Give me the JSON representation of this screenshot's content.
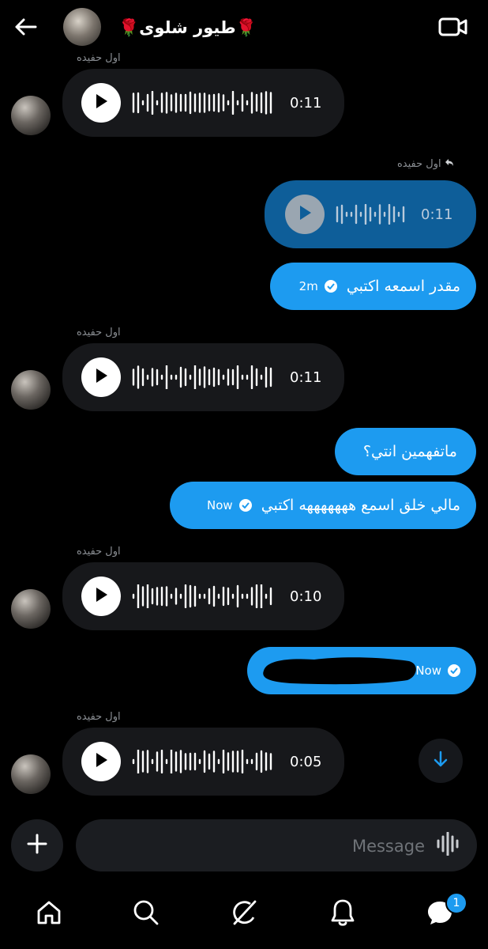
{
  "header": {
    "title": "🌹طيور شلوى🌹",
    "back_icon": "arrow-left-icon",
    "video_icon": "video-call-icon"
  },
  "messages": [
    {
      "type": "voice",
      "direction": "in",
      "sender": "اول حفيده",
      "duration": "0:11"
    },
    {
      "type": "voice",
      "direction": "out",
      "reply_to": "اول حفيده",
      "duration": "0:11"
    },
    {
      "type": "text",
      "direction": "out",
      "text": "مقدر اسمعه اكتبي",
      "time": "2m",
      "status_icon": "read-check-icon"
    },
    {
      "type": "voice",
      "direction": "in",
      "sender": "اول حفيده",
      "duration": "0:11"
    },
    {
      "type": "text",
      "direction": "out",
      "text": "ماتفهمين انتي؟"
    },
    {
      "type": "text",
      "direction": "out",
      "text": "مالي خلق اسمع هههههههه اكتبي",
      "time": "Now",
      "status_icon": "read-check-icon"
    },
    {
      "type": "voice",
      "direction": "in",
      "sender": "اول حفيده",
      "duration": "0:10"
    },
    {
      "type": "text",
      "direction": "out",
      "text": "",
      "redacted": true,
      "time": "Now",
      "status_icon": "read-check-icon"
    },
    {
      "type": "voice",
      "direction": "in",
      "sender": "اول حفيده",
      "duration": "0:05"
    }
  ],
  "composer": {
    "placeholder": "Message",
    "add_icon": "plus-icon",
    "voice_icon": "voice-waveform-icon"
  },
  "nav": {
    "items": [
      "home-icon",
      "search-icon",
      "grok-icon",
      "notifications-icon",
      "messages-icon"
    ],
    "messages_badge": "1"
  },
  "colors": {
    "background": "#000000",
    "outgoing_bubble": "#1d9bf0",
    "outgoing_voice": "#0e5e99",
    "incoming_bubble": "#17181b"
  }
}
